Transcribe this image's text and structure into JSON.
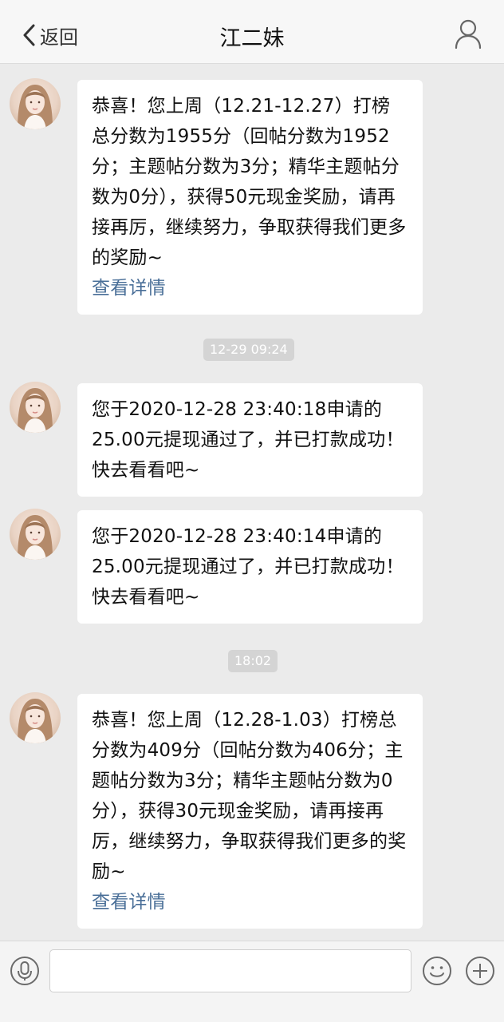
{
  "nav": {
    "back_label": "返回",
    "title": "江二妹",
    "back_icon": "chevron-left-icon",
    "profile_icon": "user-icon"
  },
  "messages": [
    {
      "text": "恭喜！您上周（12.21-12.27）打榜总分数为1955分（回帖分数为1952分；主题帖分数为3分；精华主题帖分数为0分），获得50元现金奖励，请再接再厉，继续努力，争取获得我们更多的奖励~",
      "link": "查看详情"
    },
    {
      "text": "您于2020-12-28 23:40:18申请的25.00元提现通过了，并已打款成功！快去看看吧~"
    },
    {
      "text": "您于2020-12-28 23:40:14申请的25.00元提现通过了，并已打款成功！快去看看吧~"
    },
    {
      "text": "恭喜！您上周（12.28-1.03）打榜总分数为409分（回帖分数为406分；主题帖分数为3分；精华主题帖分数为0分），获得30元现金奖励，请再接再厉，继续努力，争取获得我们更多的奖励~",
      "link": "查看详情"
    }
  ],
  "timestamps": [
    "12-29 09:24",
    "18:02"
  ],
  "input_bar": {
    "message_input_value": "",
    "icons": [
      "microphone-icon",
      "emoji-icon",
      "plus-icon"
    ]
  },
  "colors": {
    "background": "#ebebeb",
    "bubble": "#ffffff",
    "link": "#4a6f98",
    "timestamp_bg": "#d4d4d4"
  }
}
